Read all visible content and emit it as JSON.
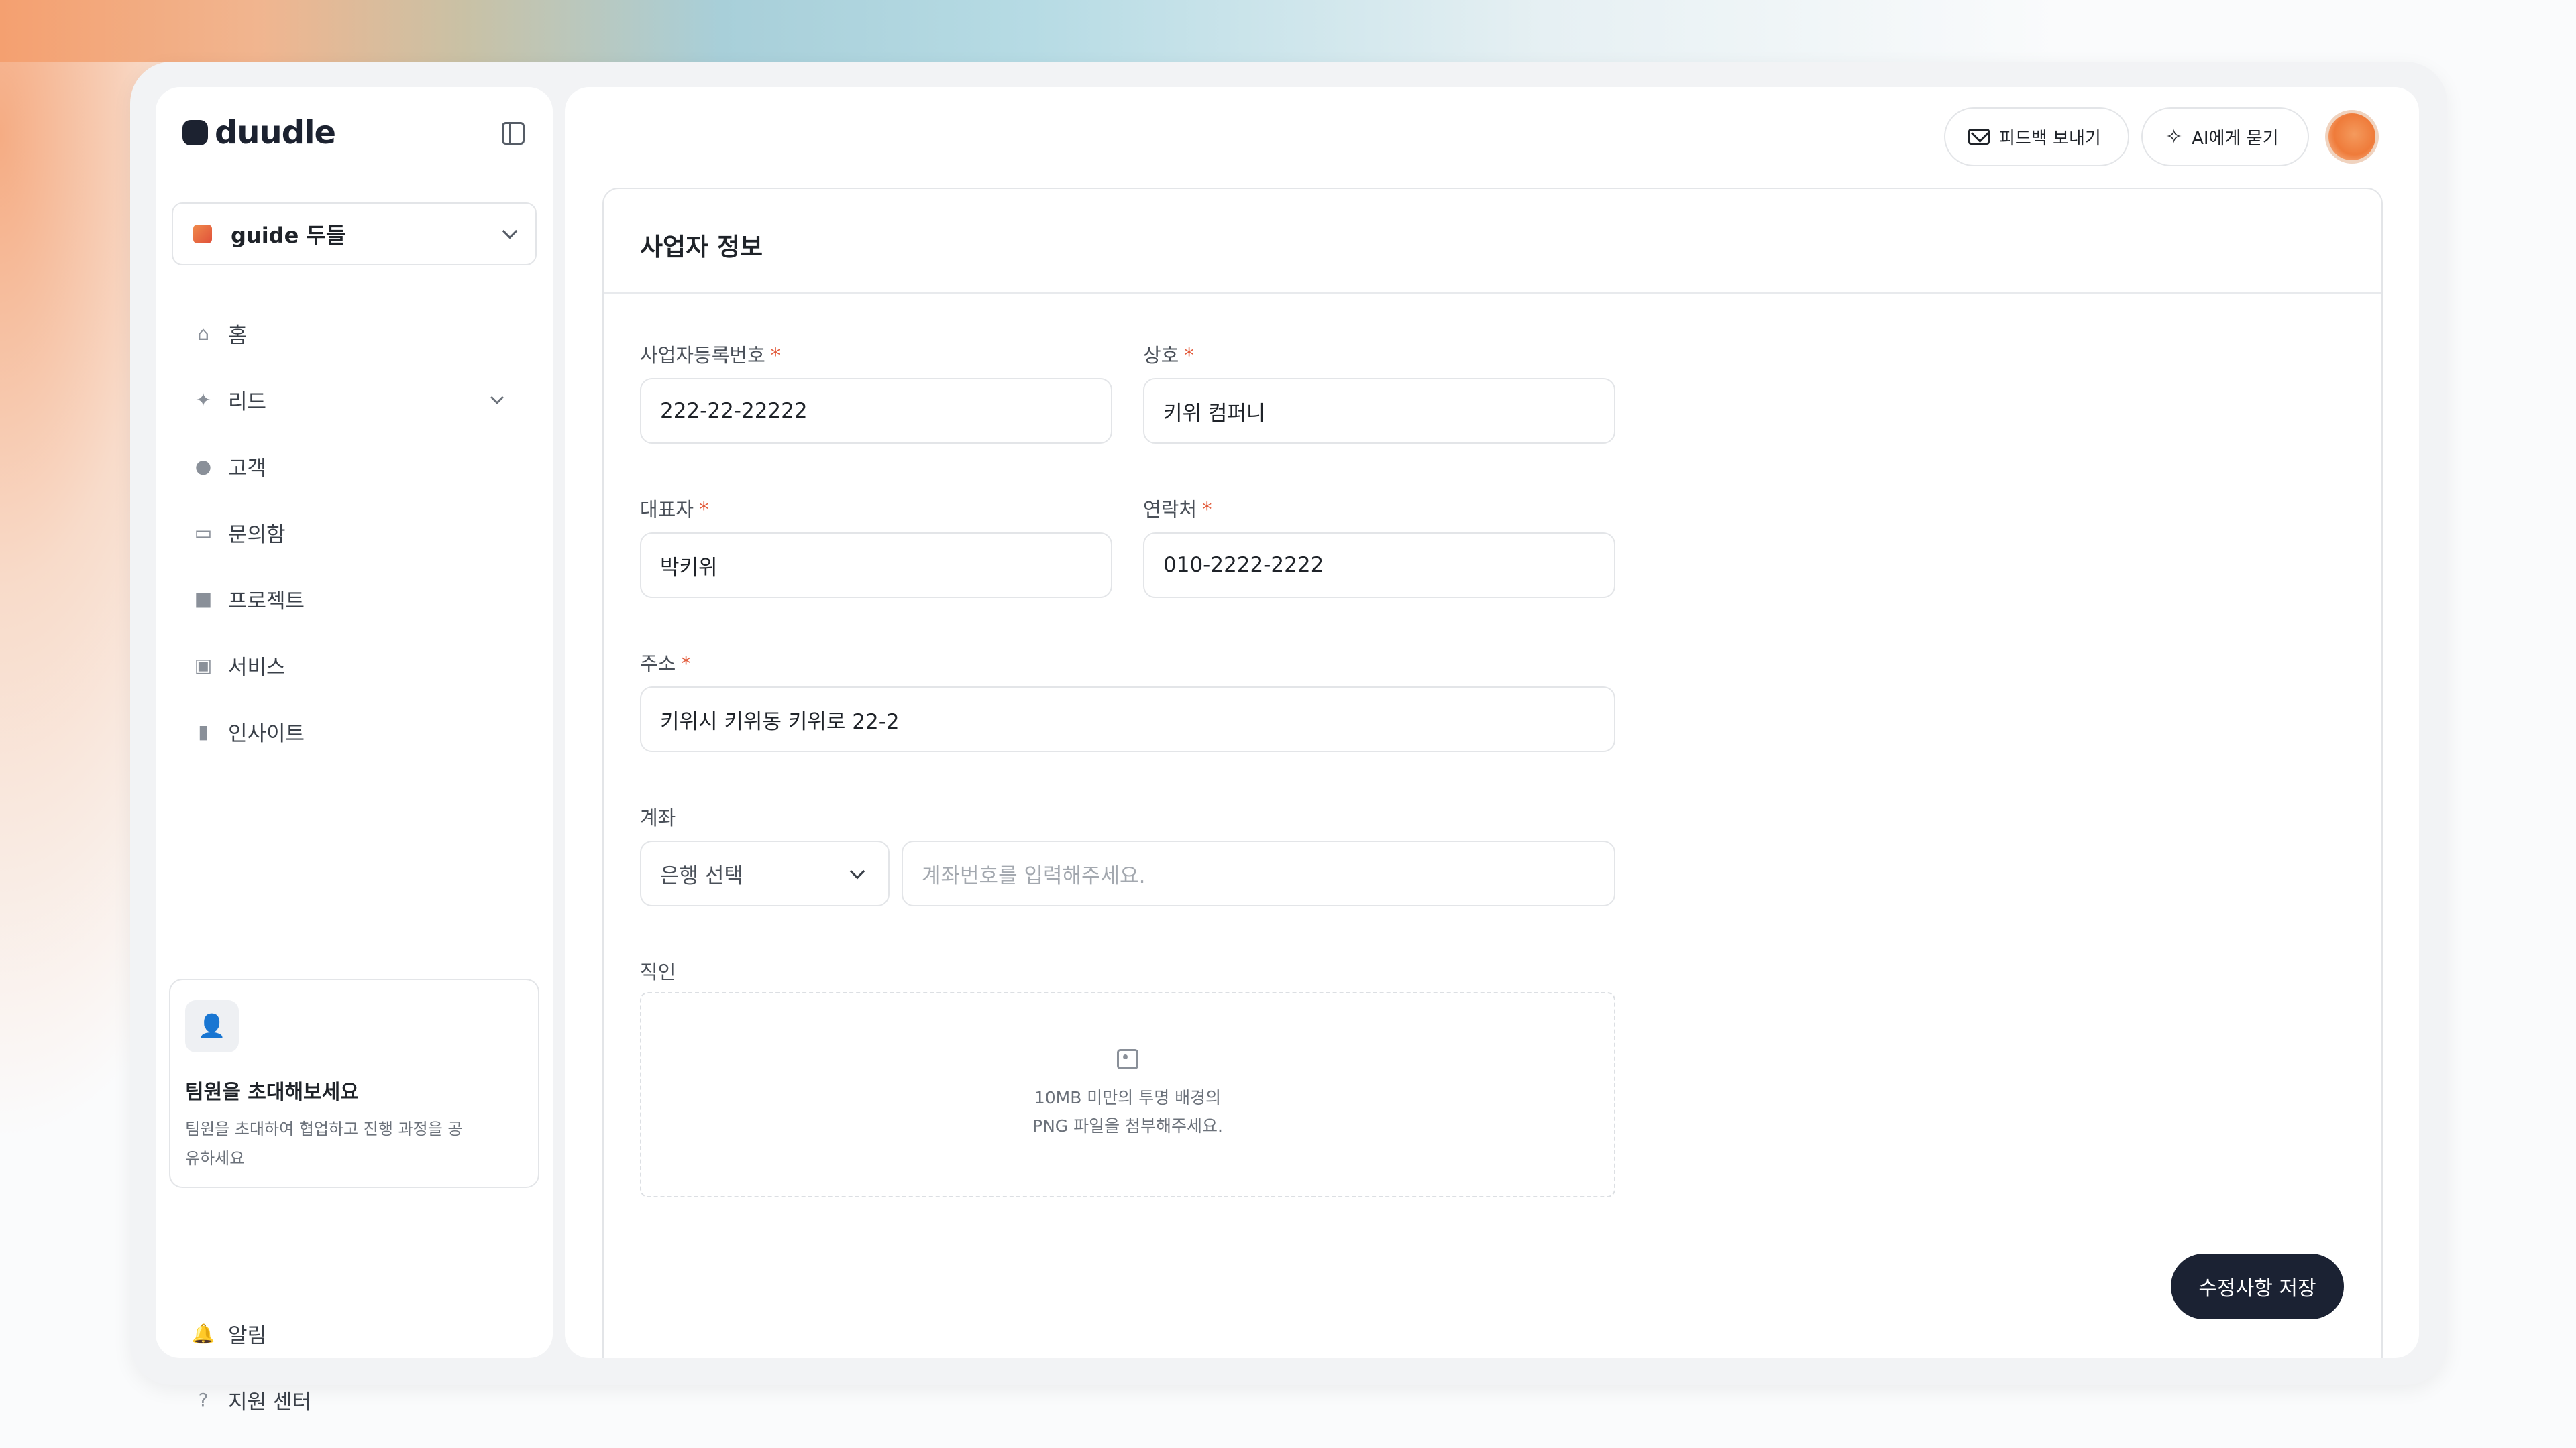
{
  "app": {
    "logo_text": "duudle"
  },
  "workspace": {
    "name": "guide 두들"
  },
  "sidebar": {
    "items": [
      {
        "label": "홈",
        "icon": "home-icon"
      },
      {
        "label": "리드",
        "icon": "rocket-icon",
        "expandable": true
      },
      {
        "label": "고객",
        "icon": "user-icon"
      },
      {
        "label": "문의함",
        "icon": "inbox-icon"
      },
      {
        "label": "프로젝트",
        "icon": "folder-icon"
      },
      {
        "label": "서비스",
        "icon": "briefcase-icon"
      },
      {
        "label": "인사이트",
        "icon": "bar-chart-icon"
      }
    ],
    "invite": {
      "title": "팀원을 초대해보세요",
      "description": "팀원을 초대하여 협업하고 진행 과정을 공유하세요"
    },
    "bottom_items": [
      {
        "label": "알림",
        "icon": "bell-icon"
      },
      {
        "label": "지원 센터",
        "icon": "help-icon"
      }
    ]
  },
  "topbar": {
    "feedback_label": "피드백 보내기",
    "ai_label": "AI에게 묻기"
  },
  "form": {
    "title": "사업자 정보",
    "biz_number": {
      "label": "사업자등록번호",
      "value": "222-22-22222",
      "required": "*"
    },
    "company": {
      "label": "상호",
      "value": "키위 컴퍼니",
      "required": "*"
    },
    "ceo": {
      "label": "대표자",
      "value": "박키위",
      "required": "*"
    },
    "contact": {
      "label": "연락처",
      "value": "010-2222-2222",
      "required": "*"
    },
    "address": {
      "label": "주소",
      "value": "키위시 키위동 키위로 22-2",
      "required": "*"
    },
    "account": {
      "label": "계좌",
      "bank_value": "은행 선택",
      "number_placeholder": "계좌번호를 입력해주세요."
    },
    "seal": {
      "label": "직인",
      "hint_line1": "10MB 미만의 투명 배경의",
      "hint_line2": "PNG 파일을 첨부해주세요."
    },
    "save_label": "수정사항 저장"
  }
}
